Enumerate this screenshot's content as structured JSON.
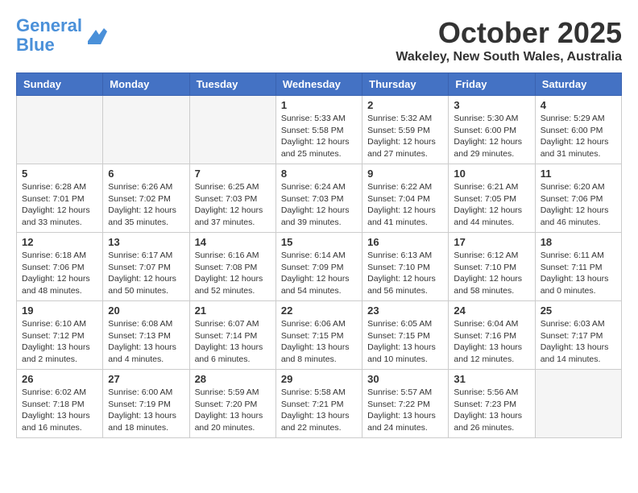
{
  "header": {
    "logo_line1": "General",
    "logo_line2": "Blue",
    "title": "October 2025",
    "location": "Wakeley, New South Wales, Australia"
  },
  "weekdays": [
    "Sunday",
    "Monday",
    "Tuesday",
    "Wednesday",
    "Thursday",
    "Friday",
    "Saturday"
  ],
  "weeks": [
    [
      {
        "day": "",
        "info": ""
      },
      {
        "day": "",
        "info": ""
      },
      {
        "day": "",
        "info": ""
      },
      {
        "day": "1",
        "info": "Sunrise: 5:33 AM\nSunset: 5:58 PM\nDaylight: 12 hours\nand 25 minutes."
      },
      {
        "day": "2",
        "info": "Sunrise: 5:32 AM\nSunset: 5:59 PM\nDaylight: 12 hours\nand 27 minutes."
      },
      {
        "day": "3",
        "info": "Sunrise: 5:30 AM\nSunset: 6:00 PM\nDaylight: 12 hours\nand 29 minutes."
      },
      {
        "day": "4",
        "info": "Sunrise: 5:29 AM\nSunset: 6:00 PM\nDaylight: 12 hours\nand 31 minutes."
      }
    ],
    [
      {
        "day": "5",
        "info": "Sunrise: 6:28 AM\nSunset: 7:01 PM\nDaylight: 12 hours\nand 33 minutes."
      },
      {
        "day": "6",
        "info": "Sunrise: 6:26 AM\nSunset: 7:02 PM\nDaylight: 12 hours\nand 35 minutes."
      },
      {
        "day": "7",
        "info": "Sunrise: 6:25 AM\nSunset: 7:03 PM\nDaylight: 12 hours\nand 37 minutes."
      },
      {
        "day": "8",
        "info": "Sunrise: 6:24 AM\nSunset: 7:03 PM\nDaylight: 12 hours\nand 39 minutes."
      },
      {
        "day": "9",
        "info": "Sunrise: 6:22 AM\nSunset: 7:04 PM\nDaylight: 12 hours\nand 41 minutes."
      },
      {
        "day": "10",
        "info": "Sunrise: 6:21 AM\nSunset: 7:05 PM\nDaylight: 12 hours\nand 44 minutes."
      },
      {
        "day": "11",
        "info": "Sunrise: 6:20 AM\nSunset: 7:06 PM\nDaylight: 12 hours\nand 46 minutes."
      }
    ],
    [
      {
        "day": "12",
        "info": "Sunrise: 6:18 AM\nSunset: 7:06 PM\nDaylight: 12 hours\nand 48 minutes."
      },
      {
        "day": "13",
        "info": "Sunrise: 6:17 AM\nSunset: 7:07 PM\nDaylight: 12 hours\nand 50 minutes."
      },
      {
        "day": "14",
        "info": "Sunrise: 6:16 AM\nSunset: 7:08 PM\nDaylight: 12 hours\nand 52 minutes."
      },
      {
        "day": "15",
        "info": "Sunrise: 6:14 AM\nSunset: 7:09 PM\nDaylight: 12 hours\nand 54 minutes."
      },
      {
        "day": "16",
        "info": "Sunrise: 6:13 AM\nSunset: 7:10 PM\nDaylight: 12 hours\nand 56 minutes."
      },
      {
        "day": "17",
        "info": "Sunrise: 6:12 AM\nSunset: 7:10 PM\nDaylight: 12 hours\nand 58 minutes."
      },
      {
        "day": "18",
        "info": "Sunrise: 6:11 AM\nSunset: 7:11 PM\nDaylight: 13 hours\nand 0 minutes."
      }
    ],
    [
      {
        "day": "19",
        "info": "Sunrise: 6:10 AM\nSunset: 7:12 PM\nDaylight: 13 hours\nand 2 minutes."
      },
      {
        "day": "20",
        "info": "Sunrise: 6:08 AM\nSunset: 7:13 PM\nDaylight: 13 hours\nand 4 minutes."
      },
      {
        "day": "21",
        "info": "Sunrise: 6:07 AM\nSunset: 7:14 PM\nDaylight: 13 hours\nand 6 minutes."
      },
      {
        "day": "22",
        "info": "Sunrise: 6:06 AM\nSunset: 7:15 PM\nDaylight: 13 hours\nand 8 minutes."
      },
      {
        "day": "23",
        "info": "Sunrise: 6:05 AM\nSunset: 7:15 PM\nDaylight: 13 hours\nand 10 minutes."
      },
      {
        "day": "24",
        "info": "Sunrise: 6:04 AM\nSunset: 7:16 PM\nDaylight: 13 hours\nand 12 minutes."
      },
      {
        "day": "25",
        "info": "Sunrise: 6:03 AM\nSunset: 7:17 PM\nDaylight: 13 hours\nand 14 minutes."
      }
    ],
    [
      {
        "day": "26",
        "info": "Sunrise: 6:02 AM\nSunset: 7:18 PM\nDaylight: 13 hours\nand 16 minutes."
      },
      {
        "day": "27",
        "info": "Sunrise: 6:00 AM\nSunset: 7:19 PM\nDaylight: 13 hours\nand 18 minutes."
      },
      {
        "day": "28",
        "info": "Sunrise: 5:59 AM\nSunset: 7:20 PM\nDaylight: 13 hours\nand 20 minutes."
      },
      {
        "day": "29",
        "info": "Sunrise: 5:58 AM\nSunset: 7:21 PM\nDaylight: 13 hours\nand 22 minutes."
      },
      {
        "day": "30",
        "info": "Sunrise: 5:57 AM\nSunset: 7:22 PM\nDaylight: 13 hours\nand 24 minutes."
      },
      {
        "day": "31",
        "info": "Sunrise: 5:56 AM\nSunset: 7:23 PM\nDaylight: 13 hours\nand 26 minutes."
      },
      {
        "day": "",
        "info": ""
      }
    ]
  ]
}
